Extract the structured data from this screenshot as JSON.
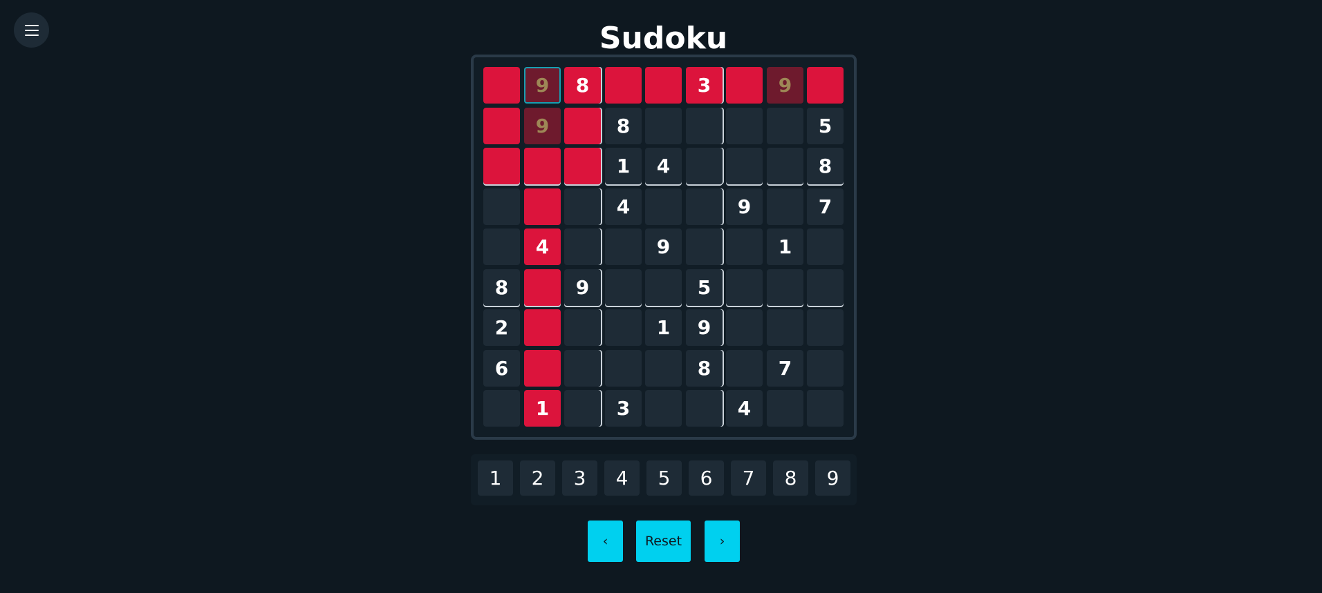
{
  "header": {
    "title": "Sudoku",
    "menu_icon": "hamburger-icon"
  },
  "board": {
    "rows": [
      [
        {
          "v": "",
          "s": "red"
        },
        {
          "v": "9",
          "s": "dark-red",
          "sel": true
        },
        {
          "v": "8",
          "s": "red"
        },
        {
          "v": "",
          "s": "red"
        },
        {
          "v": "",
          "s": "red"
        },
        {
          "v": "3",
          "s": "red"
        },
        {
          "v": "",
          "s": "red"
        },
        {
          "v": "9",
          "s": "dark-red"
        },
        {
          "v": "",
          "s": "red"
        }
      ],
      [
        {
          "v": "",
          "s": "red"
        },
        {
          "v": "9",
          "s": "dark-red"
        },
        {
          "v": "",
          "s": "red"
        },
        {
          "v": "8",
          "s": ""
        },
        {
          "v": "",
          "s": ""
        },
        {
          "v": "",
          "s": ""
        },
        {
          "v": "",
          "s": ""
        },
        {
          "v": "",
          "s": ""
        },
        {
          "v": "5",
          "s": ""
        }
      ],
      [
        {
          "v": "",
          "s": "red"
        },
        {
          "v": "",
          "s": "red"
        },
        {
          "v": "",
          "s": "red"
        },
        {
          "v": "1",
          "s": ""
        },
        {
          "v": "4",
          "s": ""
        },
        {
          "v": "",
          "s": ""
        },
        {
          "v": "",
          "s": ""
        },
        {
          "v": "",
          "s": ""
        },
        {
          "v": "8",
          "s": ""
        }
      ],
      [
        {
          "v": "",
          "s": ""
        },
        {
          "v": "",
          "s": "red"
        },
        {
          "v": "",
          "s": ""
        },
        {
          "v": "4",
          "s": ""
        },
        {
          "v": "",
          "s": ""
        },
        {
          "v": "",
          "s": ""
        },
        {
          "v": "9",
          "s": ""
        },
        {
          "v": "",
          "s": ""
        },
        {
          "v": "7",
          "s": ""
        }
      ],
      [
        {
          "v": "",
          "s": ""
        },
        {
          "v": "4",
          "s": "red"
        },
        {
          "v": "",
          "s": ""
        },
        {
          "v": "",
          "s": ""
        },
        {
          "v": "9",
          "s": ""
        },
        {
          "v": "",
          "s": ""
        },
        {
          "v": "",
          "s": ""
        },
        {
          "v": "1",
          "s": ""
        },
        {
          "v": "",
          "s": ""
        }
      ],
      [
        {
          "v": "8",
          "s": ""
        },
        {
          "v": "",
          "s": "red"
        },
        {
          "v": "9",
          "s": ""
        },
        {
          "v": "",
          "s": ""
        },
        {
          "v": "",
          "s": ""
        },
        {
          "v": "5",
          "s": ""
        },
        {
          "v": "",
          "s": ""
        },
        {
          "v": "",
          "s": ""
        },
        {
          "v": "",
          "s": ""
        }
      ],
      [
        {
          "v": "2",
          "s": ""
        },
        {
          "v": "",
          "s": "red"
        },
        {
          "v": "",
          "s": ""
        },
        {
          "v": "",
          "s": ""
        },
        {
          "v": "1",
          "s": ""
        },
        {
          "v": "9",
          "s": ""
        },
        {
          "v": "",
          "s": ""
        },
        {
          "v": "",
          "s": ""
        },
        {
          "v": "",
          "s": ""
        }
      ],
      [
        {
          "v": "6",
          "s": ""
        },
        {
          "v": "",
          "s": "red"
        },
        {
          "v": "",
          "s": ""
        },
        {
          "v": "",
          "s": ""
        },
        {
          "v": "",
          "s": ""
        },
        {
          "v": "8",
          "s": ""
        },
        {
          "v": "",
          "s": ""
        },
        {
          "v": "7",
          "s": ""
        },
        {
          "v": "",
          "s": ""
        }
      ],
      [
        {
          "v": "",
          "s": ""
        },
        {
          "v": "1",
          "s": "red"
        },
        {
          "v": "",
          "s": ""
        },
        {
          "v": "3",
          "s": ""
        },
        {
          "v": "",
          "s": ""
        },
        {
          "v": "",
          "s": ""
        },
        {
          "v": "4",
          "s": ""
        },
        {
          "v": "",
          "s": ""
        },
        {
          "v": "",
          "s": ""
        }
      ]
    ]
  },
  "numpad": [
    "1",
    "2",
    "3",
    "4",
    "5",
    "6",
    "7",
    "8",
    "9"
  ],
  "controls": {
    "prev_label": "‹",
    "reset_label": "Reset",
    "next_label": "›"
  },
  "colors": {
    "background": "#0e1820",
    "cell": "#1e2b36",
    "conflict": "#dc143c",
    "conflict_dim": "#6e1a2d",
    "accent": "#00d0ef",
    "selected_border": "#17a0b3"
  }
}
